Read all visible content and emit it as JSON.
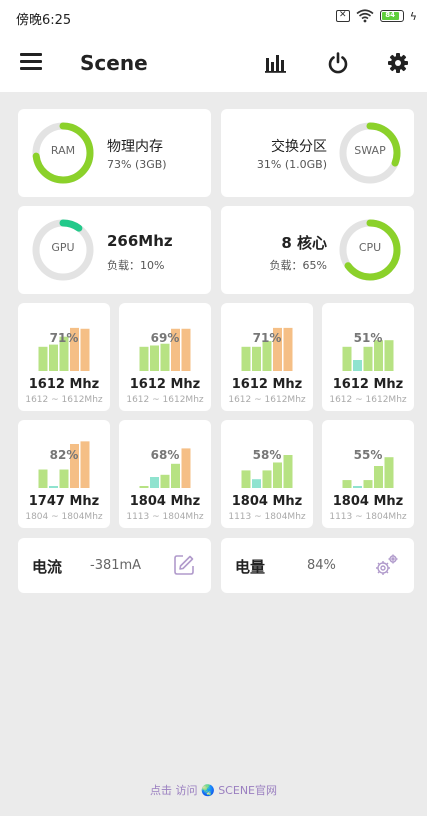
{
  "status": {
    "time": "傍晚6:25",
    "battery": "84"
  },
  "appbar": {
    "title": "Scene"
  },
  "ram": {
    "ring_label": "RAM",
    "title": "物理内存",
    "detail": "73% (3GB)",
    "percent": 73
  },
  "swap": {
    "ring_label": "SWAP",
    "title": "交换分区",
    "detail": "31% (1.0GB)",
    "percent": 31
  },
  "gpu": {
    "ring_label": "GPU",
    "freq": "266Mhz",
    "load": "负载：10%",
    "percent": 10
  },
  "cpu": {
    "ring_label": "CPU",
    "cores_text": "8 核心",
    "load": "负载：65%",
    "percent": 65
  },
  "cores": [
    {
      "pct": "71%",
      "freq": "1612 Mhz",
      "range": "1612 ~ 1612Mhz",
      "bars": [
        0.55,
        0.6,
        0.78,
        0.98,
        0.96
      ]
    },
    {
      "pct": "69%",
      "freq": "1612 Mhz",
      "range": "1612 ~ 1612Mhz",
      "bars": [
        0.55,
        0.58,
        0.62,
        0.96,
        0.96
      ]
    },
    {
      "pct": "71%",
      "freq": "1612 Mhz",
      "range": "1612 ~ 1612Mhz",
      "bars": [
        0.55,
        0.55,
        0.68,
        0.98,
        0.98
      ]
    },
    {
      "pct": "51%",
      "freq": "1612 Mhz",
      "range": "1612 ~ 1612Mhz",
      "bars": [
        0.55,
        0.25,
        0.55,
        0.7,
        0.7
      ]
    },
    {
      "pct": "82%",
      "freq": "1747 Mhz",
      "range": "1804 ~ 1804Mhz",
      "bars": [
        0.42,
        0.0,
        0.42,
        1.0,
        1.06
      ]
    },
    {
      "pct": "68%",
      "freq": "1804 Mhz",
      "range": "1113 ~ 1804Mhz",
      "bars": [
        0.04,
        0.25,
        0.3,
        0.55,
        0.9
      ]
    },
    {
      "pct": "58%",
      "freq": "1804 Mhz",
      "range": "1113 ~ 1804Mhz",
      "bars": [
        0.4,
        0.2,
        0.4,
        0.58,
        0.75
      ]
    },
    {
      "pct": "55%",
      "freq": "1804 Mhz",
      "range": "1113 ~ 1804Mhz",
      "bars": [
        0.18,
        0.0,
        0.18,
        0.5,
        0.7
      ]
    }
  ],
  "current": {
    "label": "电流",
    "value": "-381mA"
  },
  "battery_card": {
    "label": "电量",
    "value": "84%"
  },
  "footer": {
    "text": "点击 访问",
    "link": "SCENE官网"
  },
  "colors": {
    "green": "#8bd12a",
    "ring_bg": "#e3e3e3",
    "gpu_ring": "#22c98a",
    "bar_green": "#b7e283",
    "bar_orange": "#f5bf86",
    "bar_teal": "#8fe3cf"
  }
}
